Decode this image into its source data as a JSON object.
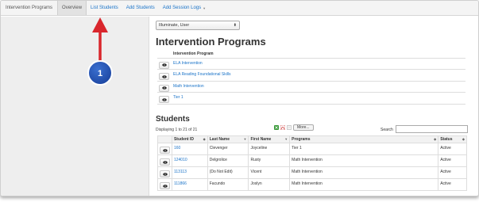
{
  "nav": {
    "brand": "Intervention Programs",
    "tabs": [
      "Overview",
      "List Students",
      "Add Students",
      "Add Session Logs"
    ]
  },
  "callout": {
    "number": "1",
    "color": "#1f4fa8",
    "arrow_color": "#d9262c"
  },
  "filter": {
    "selected": "Illuminate, User"
  },
  "programs_section": {
    "title": "Intervention Programs",
    "header": "Intervention Program",
    "items": [
      "ELA Intervention",
      "ELA Reading Foundational Skills",
      "Math Intervention",
      "Tier 1"
    ]
  },
  "students_section": {
    "title": "Students",
    "showing": "Displaying 1 to 21 of 21",
    "more_label": "More...",
    "search_label": "Search",
    "search_value": "",
    "columns": [
      "Student ID",
      "Last Name",
      "First Name",
      "Programs",
      "Status"
    ],
    "rows": [
      [
        "160",
        "Clevenger",
        "Joyceline",
        "Tier 1",
        "Active"
      ],
      [
        "124010",
        "Delgrolice",
        "Rusty",
        "Math Intervention",
        "Active"
      ],
      [
        "113113",
        "(Do Not Edit)",
        "Vicent",
        "Math Intervention",
        "Active"
      ],
      [
        "111866",
        "Facundo",
        "Joslyn",
        "Math Intervention",
        "Active"
      ]
    ]
  },
  "colors": {
    "link": "#1a73c8",
    "sidebar": "#eeeeee"
  }
}
